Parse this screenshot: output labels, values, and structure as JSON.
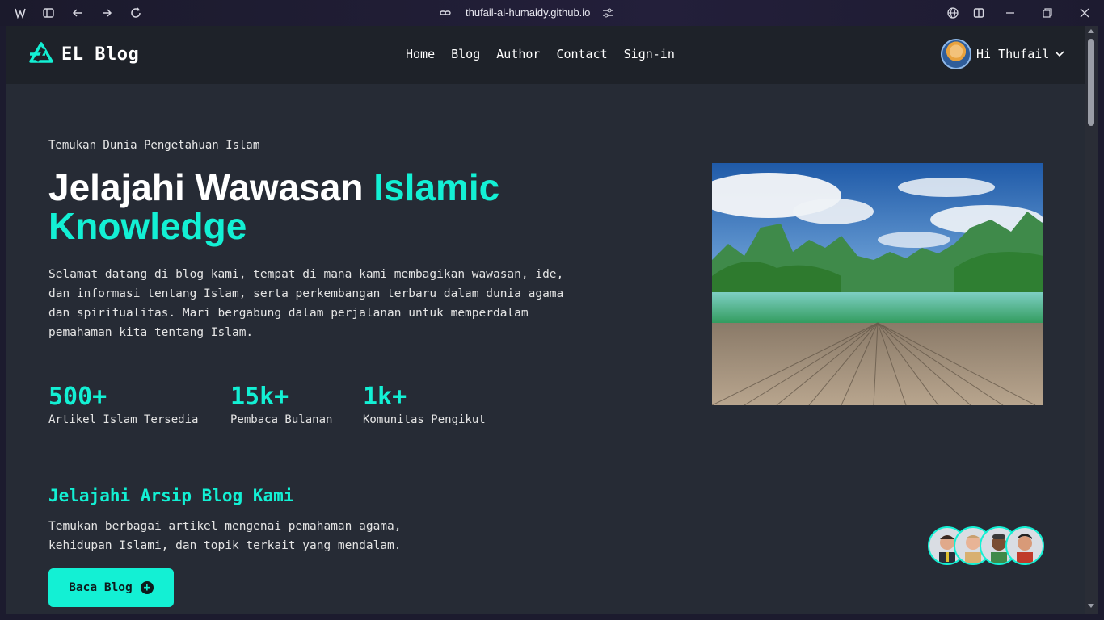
{
  "browser": {
    "url": "thufail-al-humaidy.github.io"
  },
  "nav": {
    "brand": "EL Blog",
    "links": [
      "Home",
      "Blog",
      "Author",
      "Contact",
      "Sign-in"
    ],
    "user_greeting": "Hi Thufail"
  },
  "hero": {
    "tagline": "Temukan Dunia Pengetahuan Islam",
    "headline_plain": "Jelajahi Wawasan",
    "headline_accent": "Islamic Knowledge",
    "intro": "Selamat datang di blog kami, tempat di mana kami membagikan wawasan, ide, dan informasi tentang Islam, serta perkembangan terbaru dalam dunia agama dan spiritualitas. Mari bergabung dalam perjalanan untuk memperdalam pemahaman kita tentang Islam."
  },
  "stats": [
    {
      "value": "500+",
      "label": "Artikel Islam Tersedia"
    },
    {
      "value": "15k+",
      "label": "Pembaca Bulanan"
    },
    {
      "value": "1k+",
      "label": "Komunitas Pengikut"
    }
  ],
  "archive": {
    "title": "Jelajahi Arsip Blog Kami",
    "text": "Temukan berbagai artikel mengenai pemahaman agama, kehidupan Islami, dan topik terkait yang mendalam.",
    "button": "Baca Blog"
  },
  "colors": {
    "accent": "#13f0d4",
    "page_bg": "#262b35",
    "nav_bg": "#1e2229"
  },
  "icons": {
    "brand": "logo-triangle-icon",
    "user_menu": "chevron-down-icon",
    "button": "plus-circle-icon"
  }
}
